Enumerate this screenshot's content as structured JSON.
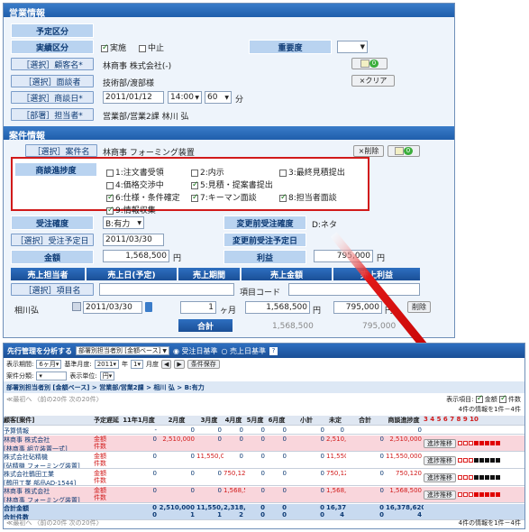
{
  "sales_info": {
    "section_title": "営業情報",
    "yotei_kubun_label": "予定区分",
    "jisseki_kubun_label": "実績区分",
    "jisshi_label": "実施",
    "chushi_label": "中止",
    "juyodo_label": "重要度",
    "customer_btn": "［選択］顧客名*",
    "customer_value": "林商事  株式会社(-)",
    "contact_btn": "［選択］面談者",
    "contact_value": "技術部/渡部様",
    "clear_btn": "×クリア",
    "date_btn": "［選択］商談日*",
    "date_value": "2011/01/12",
    "time_value": "14:00",
    "minutes_value": "60",
    "minutes_unit": "分",
    "owner_btn": "［部署］担当者*",
    "owner_value": "営業部/営業2課  林川 弘"
  },
  "case_info": {
    "section_title": "案件情報",
    "case_btn": "［選択］案件名",
    "case_value": "林商事  フォーミング装置",
    "delete_btn": "×削除",
    "progress_label": "商談進捗度",
    "progress_items": [
      {
        "label": "1:注文書受領",
        "checked": false
      },
      {
        "label": "2:内示",
        "checked": false
      },
      {
        "label": "3:最終見積提出",
        "checked": false
      },
      {
        "label": "4:価格交渉中",
        "checked": false
      },
      {
        "label": "5:見積・提案書提出",
        "checked": true
      },
      {
        "label": "6:仕様・条件確定",
        "checked": true
      },
      {
        "label": "7:キーマン面談",
        "checked": true
      },
      {
        "label": "8:担当者面談",
        "checked": true
      },
      {
        "label": "9:情報収集",
        "checked": true
      }
    ],
    "order_certainty_label": "受注確度",
    "order_certainty_value": "B:有力",
    "before_certainty_label": "変更前受注確度",
    "before_certainty_value": "D:ネタ",
    "order_date_btn": "［選択］受注予定日",
    "order_date_value": "2011/03/30",
    "before_order_date_label": "変更前受注予定日",
    "amount_label": "金額",
    "amount_value": "1,568,500",
    "yen": "円",
    "profit_label": "利益",
    "profit_value": "795,000",
    "table_headers": [
      "売上担当者",
      "売上日(予定)",
      "売上期間",
      "売上金額",
      "売上利益"
    ],
    "item_btn": "［選択］項目名",
    "item_code_label": "項目コード",
    "row_person": "相川弘",
    "row_date": "2011/03/30",
    "row_period": "1",
    "row_period_unit": "ヶ月",
    "row_amount": "1,568,500",
    "row_profit": "795,000",
    "row_delete": "削除",
    "total_label": "合計",
    "total_amount": "1,568,500",
    "total_profit": "795,000"
  },
  "lower": {
    "title": "先行管理を分析する",
    "dept_select": "部署別担当者別 [金額ベース]",
    "radio_order": "受注日基準",
    "radio_sales": "売上日基準",
    "period_label": "表示期間:",
    "period_value": "6ヶ月",
    "base_month_label": "基準月度:",
    "base_year": "2011",
    "year_unit": "年",
    "base_month": "1",
    "month_unit": "月度",
    "condition_btn": "条件保存",
    "case_class_label": "案件分類:",
    "amount_unit_label": "表示単位:",
    "amount_unit_value": "円",
    "breadcrumb": "部署別担当者別 [金額ベース] > 営業部/営業2課 > 相川 弘 > B:有力",
    "display_items_label": "表示項目:",
    "display_amount": "金額",
    "display_count": "件数",
    "pager_top": "≪最初へ  〈前の20件  次の20件〉",
    "pager_info": "4件の情報を1件－4件",
    "pager_bottom": "≪最初へ  〈前の20件  次の20件〉",
    "col_headers": [
      "顧客[案件]",
      "予定遅延",
      "11年1月度",
      "2月度",
      "3月度",
      "4月度",
      "5月度",
      "6月度",
      "小計",
      "未定",
      "合計",
      "商談進捗度"
    ],
    "progress_nums": "3 4 5 6 7 8 9 10",
    "progress_btn": "進捗推移",
    "rows": [
      {
        "name": "予算情報",
        "sub": "",
        "type": "",
        "vals": [
          "-",
          "0",
          "0",
          "0",
          "0",
          "0",
          "0",
          "0",
          "",
          "0"
        ],
        "color": "#ffffff"
      },
      {
        "name": "林商事  株式会社",
        "sub": "[林商事  組立装置一式]",
        "type": "金額\n件数",
        "vals": [
          "0",
          "2,510,000",
          "0",
          "0",
          "0",
          "0",
          "0",
          "2,510,000",
          "0",
          "2,510,000"
        ],
        "color": "#f9d6dc"
      },
      {
        "name": "株式会社砧精機",
        "sub": "[砧精機  フォーミング装置]",
        "type": "金額\n件数",
        "vals": [
          "0",
          "0",
          "11,550,000",
          "0",
          "0",
          "0",
          "0",
          "11,550,000",
          "0",
          "11,550,000"
        ],
        "color": "#ffffff"
      },
      {
        "name": "株式会社鶴田工業",
        "sub": "[鶴田工業  部品AD-1544]",
        "type": "金額\n件数",
        "vals": [
          "0",
          "0",
          "0",
          "750,120",
          "0",
          "0",
          "0",
          "750,120",
          "0",
          "750,120"
        ],
        "color": "#ffffff"
      },
      {
        "name": "林商事  株式会社",
        "sub": "[林商事  フォーミング装置]",
        "type": "金額\n件数",
        "vals": [
          "0",
          "0",
          "0",
          "1,568,500",
          "0",
          "0",
          "0",
          "1,568,500",
          "0",
          "1,568,500"
        ],
        "color": "#f9d6dc"
      }
    ],
    "total_label": "合計金額",
    "total_count_label": "合計件数",
    "total_vals": [
      "0",
      "2,510,000",
      "11,550,000",
      "2,318,620",
      "0",
      "0",
      "0",
      "16,378,620",
      "0",
      "16,378,620"
    ],
    "total_counts": [
      "0",
      "1",
      "1",
      "2",
      "0",
      "0",
      "0",
      "4",
      "0",
      "4"
    ]
  }
}
